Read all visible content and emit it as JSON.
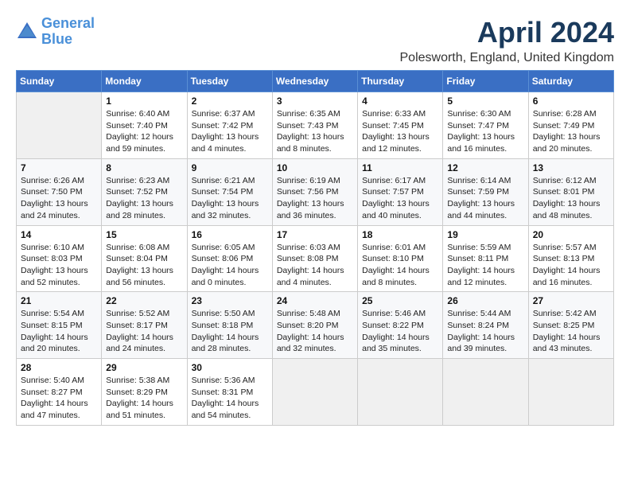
{
  "logo": {
    "line1": "General",
    "line2": "Blue"
  },
  "title": "April 2024",
  "location": "Polesworth, England, United Kingdom",
  "headers": [
    "Sunday",
    "Monday",
    "Tuesday",
    "Wednesday",
    "Thursday",
    "Friday",
    "Saturday"
  ],
  "weeks": [
    [
      {
        "day": "",
        "info": ""
      },
      {
        "day": "1",
        "info": "Sunrise: 6:40 AM\nSunset: 7:40 PM\nDaylight: 12 hours\nand 59 minutes."
      },
      {
        "day": "2",
        "info": "Sunrise: 6:37 AM\nSunset: 7:42 PM\nDaylight: 13 hours\nand 4 minutes."
      },
      {
        "day": "3",
        "info": "Sunrise: 6:35 AM\nSunset: 7:43 PM\nDaylight: 13 hours\nand 8 minutes."
      },
      {
        "day": "4",
        "info": "Sunrise: 6:33 AM\nSunset: 7:45 PM\nDaylight: 13 hours\nand 12 minutes."
      },
      {
        "day": "5",
        "info": "Sunrise: 6:30 AM\nSunset: 7:47 PM\nDaylight: 13 hours\nand 16 minutes."
      },
      {
        "day": "6",
        "info": "Sunrise: 6:28 AM\nSunset: 7:49 PM\nDaylight: 13 hours\nand 20 minutes."
      }
    ],
    [
      {
        "day": "7",
        "info": "Sunrise: 6:26 AM\nSunset: 7:50 PM\nDaylight: 13 hours\nand 24 minutes."
      },
      {
        "day": "8",
        "info": "Sunrise: 6:23 AM\nSunset: 7:52 PM\nDaylight: 13 hours\nand 28 minutes."
      },
      {
        "day": "9",
        "info": "Sunrise: 6:21 AM\nSunset: 7:54 PM\nDaylight: 13 hours\nand 32 minutes."
      },
      {
        "day": "10",
        "info": "Sunrise: 6:19 AM\nSunset: 7:56 PM\nDaylight: 13 hours\nand 36 minutes."
      },
      {
        "day": "11",
        "info": "Sunrise: 6:17 AM\nSunset: 7:57 PM\nDaylight: 13 hours\nand 40 minutes."
      },
      {
        "day": "12",
        "info": "Sunrise: 6:14 AM\nSunset: 7:59 PM\nDaylight: 13 hours\nand 44 minutes."
      },
      {
        "day": "13",
        "info": "Sunrise: 6:12 AM\nSunset: 8:01 PM\nDaylight: 13 hours\nand 48 minutes."
      }
    ],
    [
      {
        "day": "14",
        "info": "Sunrise: 6:10 AM\nSunset: 8:03 PM\nDaylight: 13 hours\nand 52 minutes."
      },
      {
        "day": "15",
        "info": "Sunrise: 6:08 AM\nSunset: 8:04 PM\nDaylight: 13 hours\nand 56 minutes."
      },
      {
        "day": "16",
        "info": "Sunrise: 6:05 AM\nSunset: 8:06 PM\nDaylight: 14 hours\nand 0 minutes."
      },
      {
        "day": "17",
        "info": "Sunrise: 6:03 AM\nSunset: 8:08 PM\nDaylight: 14 hours\nand 4 minutes."
      },
      {
        "day": "18",
        "info": "Sunrise: 6:01 AM\nSunset: 8:10 PM\nDaylight: 14 hours\nand 8 minutes."
      },
      {
        "day": "19",
        "info": "Sunrise: 5:59 AM\nSunset: 8:11 PM\nDaylight: 14 hours\nand 12 minutes."
      },
      {
        "day": "20",
        "info": "Sunrise: 5:57 AM\nSunset: 8:13 PM\nDaylight: 14 hours\nand 16 minutes."
      }
    ],
    [
      {
        "day": "21",
        "info": "Sunrise: 5:54 AM\nSunset: 8:15 PM\nDaylight: 14 hours\nand 20 minutes."
      },
      {
        "day": "22",
        "info": "Sunrise: 5:52 AM\nSunset: 8:17 PM\nDaylight: 14 hours\nand 24 minutes."
      },
      {
        "day": "23",
        "info": "Sunrise: 5:50 AM\nSunset: 8:18 PM\nDaylight: 14 hours\nand 28 minutes."
      },
      {
        "day": "24",
        "info": "Sunrise: 5:48 AM\nSunset: 8:20 PM\nDaylight: 14 hours\nand 32 minutes."
      },
      {
        "day": "25",
        "info": "Sunrise: 5:46 AM\nSunset: 8:22 PM\nDaylight: 14 hours\nand 35 minutes."
      },
      {
        "day": "26",
        "info": "Sunrise: 5:44 AM\nSunset: 8:24 PM\nDaylight: 14 hours\nand 39 minutes."
      },
      {
        "day": "27",
        "info": "Sunrise: 5:42 AM\nSunset: 8:25 PM\nDaylight: 14 hours\nand 43 minutes."
      }
    ],
    [
      {
        "day": "28",
        "info": "Sunrise: 5:40 AM\nSunset: 8:27 PM\nDaylight: 14 hours\nand 47 minutes."
      },
      {
        "day": "29",
        "info": "Sunrise: 5:38 AM\nSunset: 8:29 PM\nDaylight: 14 hours\nand 51 minutes."
      },
      {
        "day": "30",
        "info": "Sunrise: 5:36 AM\nSunset: 8:31 PM\nDaylight: 14 hours\nand 54 minutes."
      },
      {
        "day": "",
        "info": ""
      },
      {
        "day": "",
        "info": ""
      },
      {
        "day": "",
        "info": ""
      },
      {
        "day": "",
        "info": ""
      }
    ]
  ]
}
